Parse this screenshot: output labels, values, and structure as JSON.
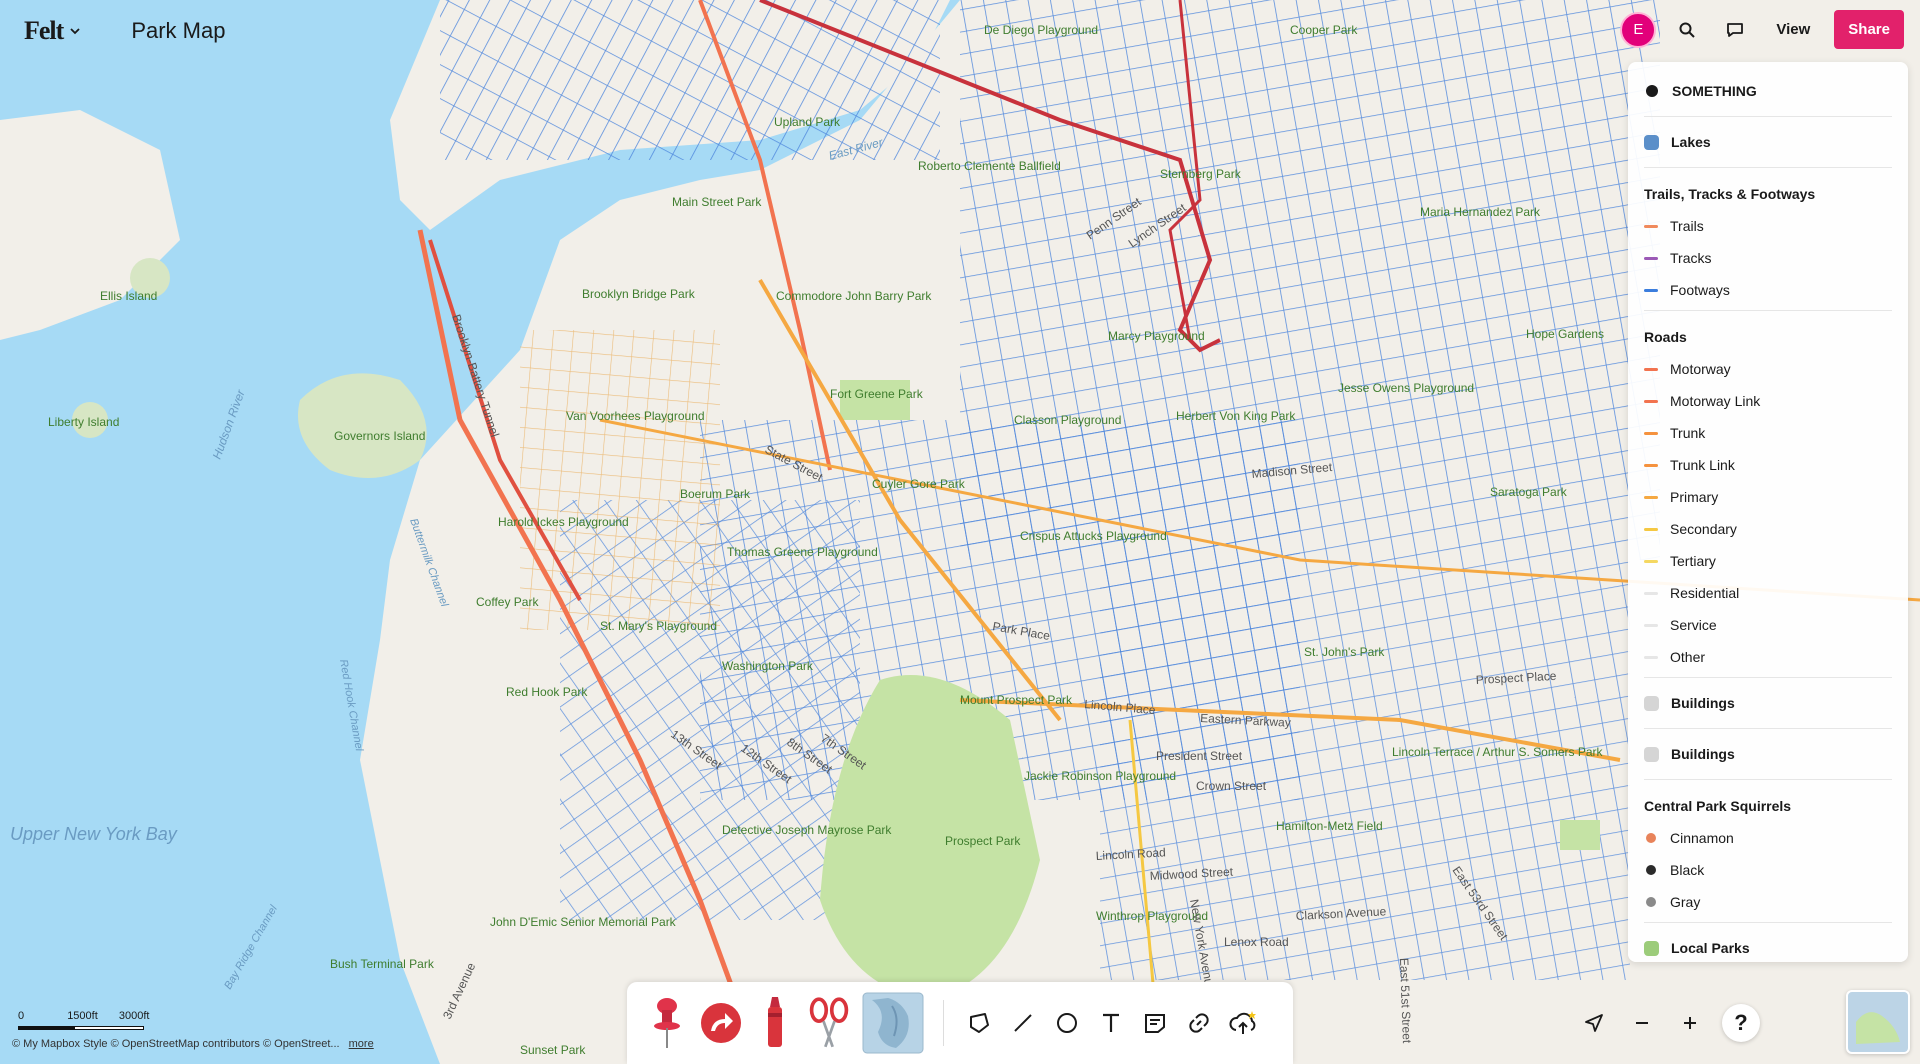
{
  "app": {
    "logo": "Felt",
    "title": "Park Map"
  },
  "topbar": {
    "avatar_initial": "E",
    "view_label": "View",
    "share_label": "Share"
  },
  "legend": {
    "layer_something": "SOMETHING",
    "layer_lakes": "Lakes",
    "trails_group": {
      "title": "Trails, Tracks & Footways",
      "items": [
        "Trails",
        "Tracks",
        "Footways"
      ]
    },
    "roads_group": {
      "title": "Roads",
      "items": [
        "Motorway",
        "Motorway Link",
        "Trunk",
        "Trunk Link",
        "Primary",
        "Secondary",
        "Tertiary",
        "Residential",
        "Service",
        "Other"
      ]
    },
    "layer_buildings_1": "Buildings",
    "layer_buildings_2": "Buildings",
    "squirrels_group": {
      "title": "Central Park Squirrels",
      "items": [
        "Cinnamon",
        "Black",
        "Gray"
      ]
    },
    "layer_local_parks": "Local Parks"
  },
  "colors": {
    "water": "#a6daf5",
    "land": "#f2efe9",
    "park": "#c5e3a5",
    "footway": "#3b7ddd",
    "motorway": "#f2734f",
    "primary": "#f5a842",
    "secondary": "#f5c842",
    "trunk_route": "#c8323c",
    "share": "#e2216b",
    "avatar": "#e2007a"
  },
  "map_labels": {
    "parks": [
      "Prospect Park",
      "Fort Greene Park",
      "Commodore John Barry Park",
      "Boerum Park",
      "Thomas Greene Playground",
      "Washington Park",
      "Red Hook Park",
      "Coffey Park",
      "Crispus Attucks Playground",
      "Saratoga Park",
      "Jesse Owens Playground",
      "Hope Gardens",
      "Maria Hernandez Park",
      "Upland Park",
      "Main Street Park",
      "Roberto Clemente Ballfield",
      "Mount Prospect Park",
      "St. Mary's Playground",
      "Cooper Park",
      "De Diego Playground",
      "Sternberg Park",
      "Marcy Playground",
      "Herbert Von King Park",
      "Classon Playground",
      "Cuyler Gore Park",
      "Harold Ickes Playground",
      "Van Voorhees Playground",
      "Brooklyn Bridge Park",
      "Liberty Island",
      "Ellis Island",
      "Governors Island",
      "St. John's Park",
      "Lincoln Terrace / Arthur S. Somers Park",
      "Hamilton-Metz Field",
      "Winthrop Playground",
      "Jackie Robinson Playground",
      "Detective Joseph Mayrose Park",
      "John D'Emic Senior Memorial Park",
      "Bush Terminal Park",
      "Sunset Park"
    ],
    "streets": [
      "State Street",
      "Madison Street",
      "Park Place",
      "Lincoln Place",
      "Eastern Parkway",
      "President Street",
      "Crown Street",
      "Lincoln Road",
      "Midwood Street",
      "Lenox Road",
      "Clarkson Avenue",
      "New York Avenue",
      "East 51st Street",
      "East 53rd Street",
      "13th Street",
      "12th Street",
      "8th Street",
      "7th Street",
      "3rd Avenue",
      "Prospect Place",
      "Penn Street",
      "Lynch Street",
      "Brooklyn-Battery Tunnel"
    ],
    "water": [
      "Upper New York Bay",
      "East River",
      "Hudson River",
      "Buttermilk Channel",
      "Red Hook Channel",
      "Bay Ridge Channel"
    ]
  },
  "scale": {
    "tick0": "0",
    "tick1": "1500ft",
    "tick2": "3000ft"
  },
  "attribution": {
    "text": "© My Mapbox Style © OpenStreetMap contributors © OpenStreet...",
    "more": "more"
  }
}
